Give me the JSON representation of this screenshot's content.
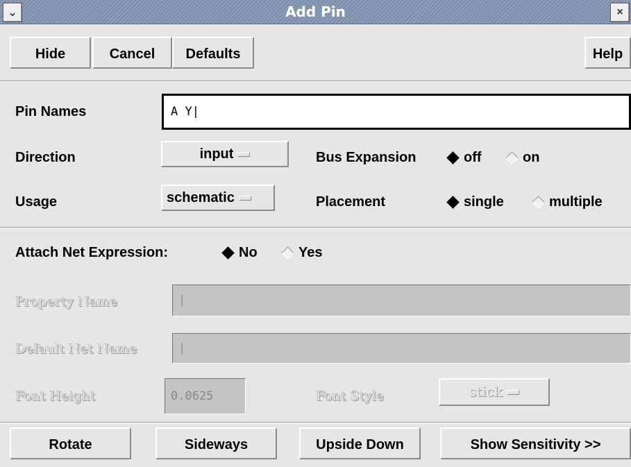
{
  "window": {
    "title": "Add Pin",
    "menu_glyph": "⌄",
    "close_glyph": "×"
  },
  "toolbar": {
    "hide": "Hide",
    "cancel": "Cancel",
    "defaults": "Defaults",
    "help": "Help"
  },
  "pin_names": {
    "label": "Pin Names",
    "value": "A Y"
  },
  "direction": {
    "label": "Direction",
    "value": "input"
  },
  "usage": {
    "label": "Usage",
    "value": "schematic"
  },
  "bus_expansion": {
    "label": "Bus Expansion",
    "options": [
      "off",
      "on"
    ],
    "selected": "off"
  },
  "placement": {
    "label": "Placement",
    "options": [
      "single",
      "multiple"
    ],
    "selected": "single"
  },
  "net_expression": {
    "label": "Attach Net Expression:",
    "options": [
      "No",
      "Yes"
    ],
    "selected": "No"
  },
  "property_name": {
    "label": "Property Name",
    "value": ""
  },
  "default_net_name": {
    "label": "Default Net Name",
    "value": ""
  },
  "font_height": {
    "label": "Font Height",
    "value": "0.0625"
  },
  "font_style": {
    "label": "Font Style",
    "value": "stick"
  },
  "bottom": {
    "rotate": "Rotate",
    "sideways": "Sideways",
    "upside_down": "Upside Down",
    "show_sensitivity": "Show Sensitivity >>"
  }
}
